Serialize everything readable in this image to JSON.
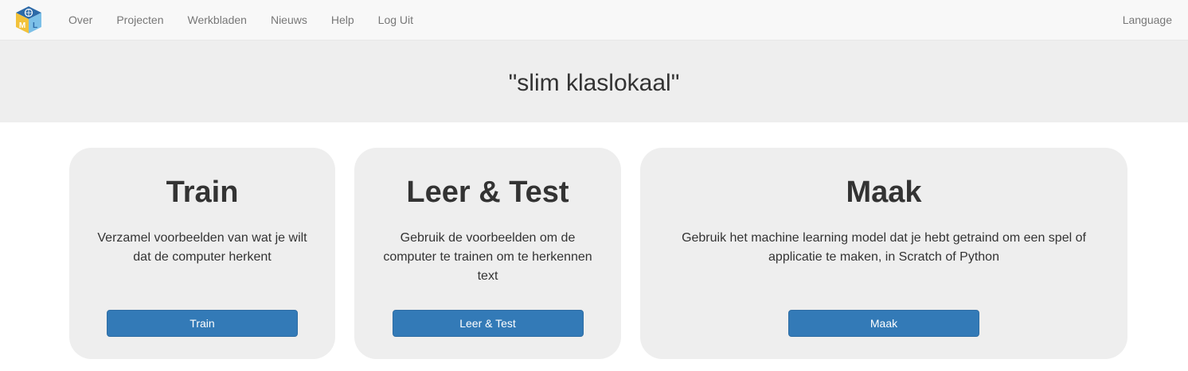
{
  "nav": {
    "links": [
      {
        "label": "Over"
      },
      {
        "label": "Projecten"
      },
      {
        "label": "Werkbladen"
      },
      {
        "label": "Nieuws"
      },
      {
        "label": "Help"
      },
      {
        "label": "Log Uit"
      }
    ],
    "language": "Language",
    "logo_letters": [
      "M",
      "L"
    ]
  },
  "page": {
    "title": "\"slim klaslokaal\""
  },
  "cards": [
    {
      "title": "Train",
      "description": "Verzamel voorbeelden van wat je wilt dat de computer herkent",
      "button": "Train"
    },
    {
      "title": "Leer & Test",
      "description": "Gebruik de voorbeelden om de computer te trainen om te herkennen text",
      "button": "Leer & Test"
    },
    {
      "title": "Maak",
      "description": "Gebruik het machine learning model dat je hebt getraind om een spel of applicatie te maken, in Scratch of Python",
      "button": "Maak"
    }
  ],
  "colors": {
    "primary_button": "#337ab7",
    "card_background": "#eeeeee",
    "navbar_background": "#f8f8f8"
  }
}
